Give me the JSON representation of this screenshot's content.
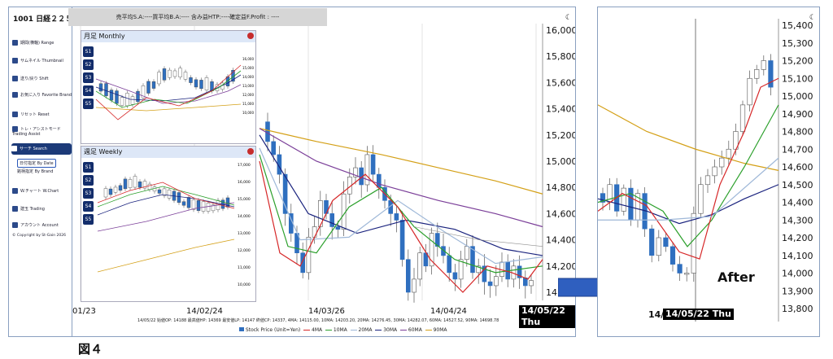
{
  "sidebar": {
    "title": "1001 日経２２５",
    "items": [
      {
        "label": "期間(横軸) Range"
      },
      {
        "label": "サムネイル Thumbnail"
      },
      {
        "label": "送り/戻り Shift"
      },
      {
        "label": "お気に入り Favorite Brand"
      },
      {
        "label": "リセット Reset"
      },
      {
        "label": "トレ・アシストモード Trading Assist"
      },
      {
        "label": "サーチ Search"
      },
      {
        "label": "W.チャート W.Chart"
      },
      {
        "label": "建玉 Trading"
      },
      {
        "label": "アカウント Account"
      }
    ],
    "subitems": [
      {
        "label": "日付指定 By Date"
      },
      {
        "label": "銘柄指定 By Brand"
      }
    ],
    "copyright": "© Copyright by St-Gain 2026"
  },
  "infobar": {
    "text": "売平均S.A:----買平均B.A:---- 含み益HTP:----確定益F.Profit : ----"
  },
  "monthly": {
    "title": "月足 Monthly"
  },
  "weekly": {
    "title": "週足 Weekly"
  },
  "buttons": [
    "S1",
    "S2",
    "S3",
    "S4",
    "S5"
  ],
  "main_chart": {
    "x_ticks": [
      "01/23",
      "14/02/24",
      "14/03/26",
      "14/04/24"
    ],
    "highlight_date": "14/05/22 Thu",
    "y_ticks": [
      "16,000",
      "15,800",
      "15,600",
      "15,400",
      "15,200",
      "15,000",
      "14,800",
      "14,600",
      "14,400",
      "14,200",
      "14,000"
    ],
    "ohlc_line": "14/05/22 始値OP: 14188 最高値HP: 14369 最安値LP: 14147 終値CP: 14337, 4MA: 14115.00, 10MA: 14203.20, 20MA: 14276.45, 30MA: 14282.07, 60MA: 14527.52, 90MA: 14698.78",
    "legend": [
      "Stock Price (Unit=Yen)",
      "4MA",
      "10MA",
      "20MA",
      "30MA",
      "60MA",
      "90MA"
    ]
  },
  "after_chart": {
    "label": "After",
    "date_prefix": "14/",
    "highlight_date": "14/05/22 Thu",
    "y_ticks": [
      "15,400",
      "15,300",
      "15,200",
      "15,100",
      "15,000",
      "14,900",
      "14,800",
      "14,700",
      "14,600",
      "14,500",
      "14,400",
      "14,300",
      "14,200",
      "14,100",
      "14,000",
      "13,900",
      "13,800"
    ]
  },
  "figure_label": "図４",
  "colors": {
    "candle_up": "#ffffff",
    "candle_down": "#2f6fbf",
    "ma4": "#d62728",
    "ma10": "#2ca02c",
    "ma20": "#9fb8d8",
    "ma30": "#1a237e",
    "ma60": "#7b3f99",
    "ma90": "#d4a017",
    "arrow": "#2f5fbf"
  }
}
